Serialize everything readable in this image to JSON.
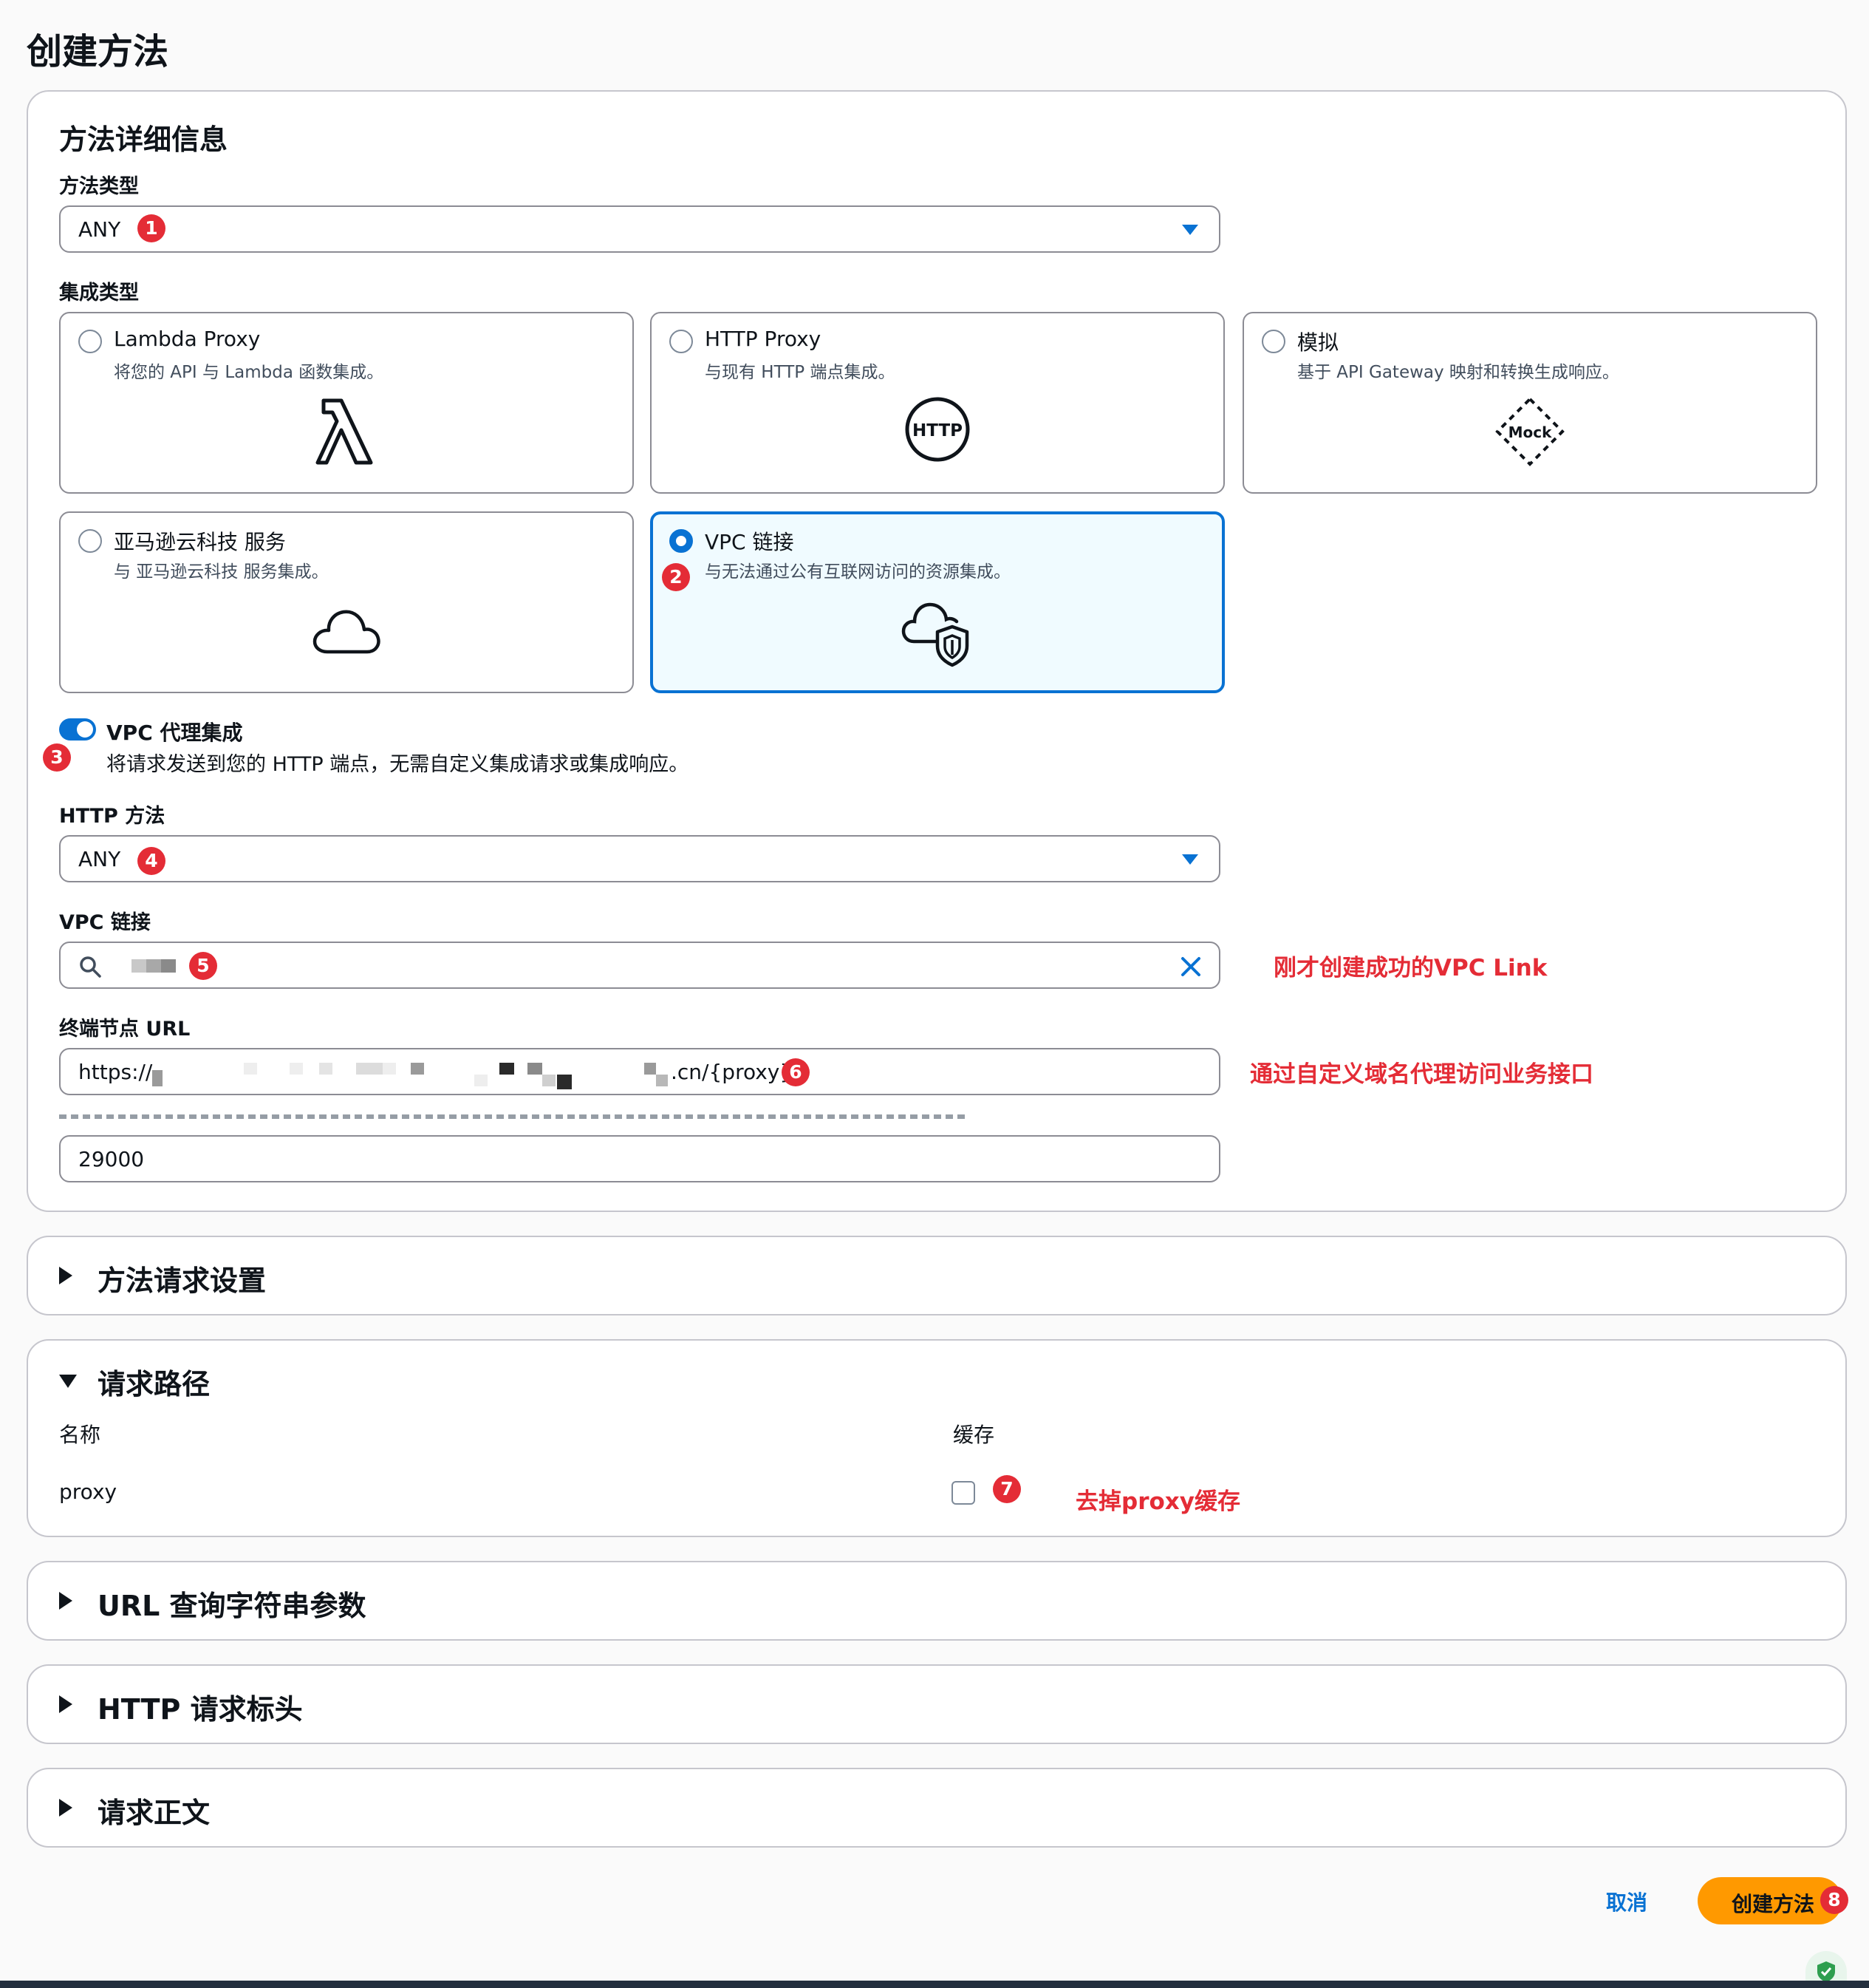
{
  "page": {
    "title": "创建方法"
  },
  "details": {
    "title": "方法详细信息",
    "method_type": {
      "label": "方法类型",
      "value": "ANY",
      "badge": "1"
    },
    "integration_type": {
      "label": "集成类型",
      "options": [
        {
          "title": "Lambda Proxy",
          "desc": "将您的 API 与 Lambda 函数集成。",
          "icon": "lambda-icon"
        },
        {
          "title": "HTTP Proxy",
          "desc": "与现有 HTTP 端点集成。",
          "icon": "http-icon",
          "icon_text": "HTTP"
        },
        {
          "title": "模拟",
          "desc": "基于 API Gateway 映射和转换生成响应。",
          "icon": "mock-icon",
          "icon_text": "Mock"
        },
        {
          "title": "亚马逊云科技 服务",
          "desc": "与 亚马逊云科技 服务集成。",
          "icon": "cloud-icon"
        },
        {
          "title": "VPC 链接",
          "desc": "与无法通过公有互联网访问的资源集成。",
          "icon": "cloud-shield-icon",
          "badge": "2"
        }
      ],
      "selected": "VPC 链接"
    },
    "vpc_proxy": {
      "label": "VPC 代理集成",
      "desc": "将请求发送到您的 HTTP 端点，无需自定义集成请求或集成响应。",
      "enabled": true,
      "badge": "3"
    },
    "http_method": {
      "label": "HTTP 方法",
      "value": "ANY",
      "badge": "4"
    },
    "vpc_link": {
      "label": "VPC 链接",
      "badge": "5",
      "note": "刚才创建成功的VPC Link"
    },
    "endpoint_url": {
      "label": "终端节点 URL",
      "prefix": "https://",
      "suffix": ".cn/{proxy}",
      "badge": "6",
      "note": "通过自定义域名代理访问业务接口"
    },
    "timeout": {
      "value": "29000"
    }
  },
  "sections": {
    "method_request": "方法请求设置",
    "request_path": {
      "title": "请求路径",
      "col_name": "名称",
      "col_cache": "缓存",
      "row_name": "proxy",
      "cache_checked": false,
      "badge": "7",
      "note": "去掉proxy缓存"
    },
    "url_query": "URL 查询字符串参数",
    "http_headers": "HTTP 请求标头",
    "request_body": "请求正文"
  },
  "footer": {
    "cancel": "取消",
    "create": "创建方法",
    "badge": "8"
  },
  "colors": {
    "accent": "#0972d3",
    "primary_button": "#ff9900",
    "annotation": "#e42c36"
  }
}
